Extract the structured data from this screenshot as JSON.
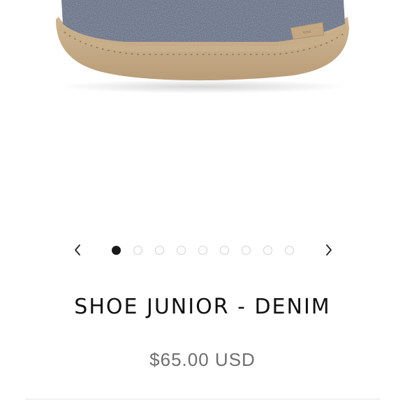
{
  "product": {
    "title": "SHOE JUNIOR - DENIM",
    "price": "$65.00 USD",
    "image_alt": "felt slipper, denim blue, suede sole"
  },
  "carousel": {
    "prev_icon": "chevron-left-icon",
    "next_icon": "chevron-right-icon",
    "total_slides": 9,
    "active_index": 0
  },
  "colors": {
    "felt": "#3f4f6e",
    "sole": "#c5ab88",
    "text": "#111111",
    "price": "#6e6e6e",
    "dot_active": "#1a1a1a",
    "dot_inactive": "#d2d2d2"
  }
}
